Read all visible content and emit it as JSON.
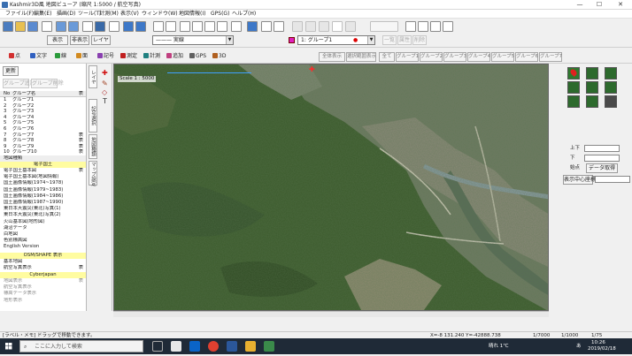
{
  "window": {
    "title": "Kashmir3D風 地図ビューア (縮尺 1:5000 / 航空写真)",
    "controls": [
      "—",
      "☐",
      "✕"
    ]
  },
  "menu": [
    "ファイル(F)",
    "編集(E)",
    "描画(D)",
    "ツール(T)",
    "計測(M)",
    "表示(V)",
    "ウィンドウ(W)",
    "地図情報(I)",
    "GPS(G)",
    "ヘルプ(H)"
  ],
  "toolbar2": {
    "btn_a": "表示",
    "btn_b": "非表示",
    "btn_c": "レイヤ",
    "line_select": "——— 実線",
    "layer_select": "1: グループ1",
    "right_btns": [
      "一覧",
      "属性",
      "削除"
    ]
  },
  "toolbar3": {
    "modes": [
      {
        "label": "点",
        "color": "#d23030"
      },
      {
        "label": "文字",
        "color": "#3060c0"
      },
      {
        "label": "線",
        "color": "#2a9a3a"
      },
      {
        "label": "面",
        "color": "#d28a20"
      },
      {
        "label": "記号",
        "color": "#8a40b0"
      },
      {
        "label": "測定",
        "color": "#c02020"
      },
      {
        "label": "計測",
        "color": "#208080"
      },
      {
        "label": "追加",
        "color": "#c04080"
      },
      {
        "label": "GPS",
        "color": "#606060"
      },
      {
        "label": "3D",
        "color": "#b06020"
      }
    ],
    "tabs": [
      "全体表示",
      "選択範囲表示",
      "全て",
      "グループ1",
      "グループ2",
      "グループ3",
      "グループ4",
      "グループ5",
      "グループ6",
      "グループ7"
    ]
  },
  "left_panel": {
    "update_btn": "更新",
    "btn_add": "グループ追加",
    "btn_del": "グループ削除",
    "groups_header": [
      "No",
      "グループ名",
      "表"
    ],
    "groups": [
      {
        "no": "1",
        "name": "グループ1",
        "mark": ""
      },
      {
        "no": "2",
        "name": "グループ2",
        "mark": ""
      },
      {
        "no": "3",
        "name": "グループ3",
        "mark": ""
      },
      {
        "no": "4",
        "name": "グループ4",
        "mark": ""
      },
      {
        "no": "5",
        "name": "グループ5",
        "mark": ""
      },
      {
        "no": "6",
        "name": "グループ6",
        "mark": ""
      },
      {
        "no": "7",
        "name": "グループ7",
        "mark": "表"
      },
      {
        "no": "8",
        "name": "グループ8",
        "mark": "表"
      },
      {
        "no": "9",
        "name": "グループ9",
        "mark": "表"
      },
      {
        "no": "10",
        "name": "グループ10",
        "mark": "表"
      }
    ],
    "layers_header": "地図種類",
    "layer_section": "電子国土",
    "layers": [
      {
        "name": "電子国土基本図",
        "mark": "表",
        "hl": false
      },
      {
        "name": "電子国土基本図(地図情報)",
        "mark": "",
        "hl": false
      },
      {
        "name": "国土画像情報(1974~1978)",
        "mark": "",
        "hl": false
      },
      {
        "name": "国土画像情報(1979~1983)",
        "mark": "",
        "hl": false
      },
      {
        "name": "国土画像情報(1984~1986)",
        "mark": "",
        "hl": false
      },
      {
        "name": "国土画像情報(1987~1990)",
        "mark": "",
        "hl": false
      },
      {
        "name": "東日本大震災(東北)写真(1)",
        "mark": "",
        "hl": false
      },
      {
        "name": "東日本大震災(東北)写真(2)",
        "mark": "",
        "hl": false
      },
      {
        "name": "火山基本図(地形図)",
        "mark": "",
        "hl": false
      },
      {
        "name": "湖沼データ",
        "mark": "",
        "hl": false
      },
      {
        "name": "白地図",
        "mark": "",
        "hl": false
      },
      {
        "name": "色別標高図",
        "mark": "",
        "hl": false
      },
      {
        "name": "English Version",
        "mark": "",
        "hl": false
      }
    ],
    "section2": "OSM/SHAPE 表示",
    "after2": [
      {
        "name": "基本地図",
        "mark": ""
      },
      {
        "name": "航空写真表示",
        "mark": "表"
      }
    ],
    "section3": "Cyberjapan",
    "after3": [
      {
        "name": "地図表示",
        "mark": "表"
      },
      {
        "name": "航空写真表示",
        "mark": ""
      },
      {
        "name": "標高データ表示",
        "mark": ""
      },
      {
        "name": "地形表示",
        "mark": ""
      }
    ]
  },
  "vtabs": [
    "レイヤ",
    "記号選択",
    "地図種類",
    "マップ設定"
  ],
  "map": {
    "scale_label": "Scale 1 : 5000",
    "marker": "✚"
  },
  "right_panel": {
    "upper_label": "上下",
    "lower_label": "下",
    "b1": "始点",
    "b2": "データ取得",
    "b3": "表示中心座標"
  },
  "status": {
    "hint": "[ラベル・メモ] ドラッグで移動できます。",
    "coords": "X=-8 131.240  Y=-42888.738",
    "scale1": "1/7000",
    "scale2": "1/1000",
    "zoom": "1/75"
  },
  "taskbar": {
    "search": "ここに入力して検索",
    "time": "10:26",
    "date": "2019/02/18",
    "weather": "晴れ 1℃",
    "lang": "あ"
  }
}
